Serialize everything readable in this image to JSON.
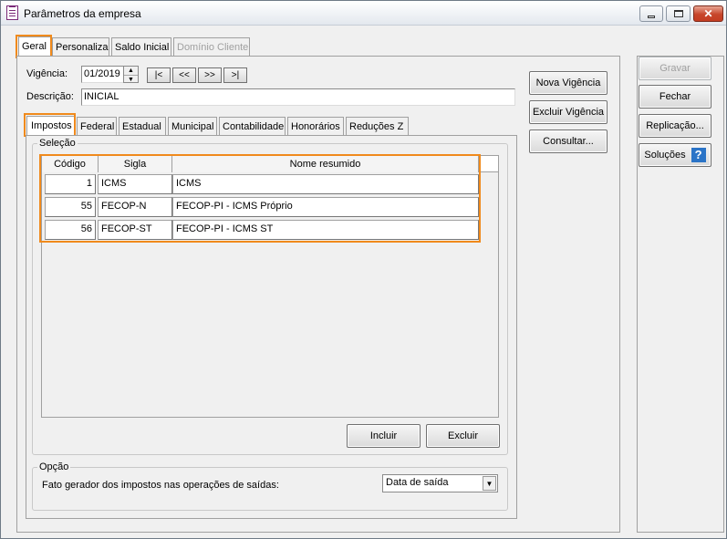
{
  "window": {
    "title": "Parâmetros da empresa",
    "icon": "document-icon"
  },
  "main_tabs": [
    {
      "label": "Geral",
      "state": "active"
    },
    {
      "label": "Personaliza",
      "state": "normal"
    },
    {
      "label": "Saldo Inicial",
      "state": "normal"
    },
    {
      "label": "Domínio Cliente",
      "state": "disabled"
    }
  ],
  "form": {
    "vigencia_label": "Vigência:",
    "vigencia_value": "01/2019",
    "nav": {
      "first": "|<",
      "prev": "<<",
      "next": ">>",
      "last": ">|"
    },
    "descricao_label": "Descrição:",
    "descricao_value": "INICIAL"
  },
  "sub_tabs": [
    {
      "label": "Impostos",
      "state": "active"
    },
    {
      "label": "Federal",
      "state": "normal"
    },
    {
      "label": "Estadual",
      "state": "normal"
    },
    {
      "label": "Municipal",
      "state": "normal"
    },
    {
      "label": "Contabilidade",
      "state": "normal"
    },
    {
      "label": "Honorários",
      "state": "normal"
    },
    {
      "label": "Reduções Z",
      "state": "normal"
    }
  ],
  "selecao": {
    "legend": "Seleção",
    "columns": [
      "Código",
      "Sigla",
      "Nome resumido"
    ],
    "rows": [
      {
        "codigo": "1",
        "sigla": "ICMS",
        "nome": "ICMS"
      },
      {
        "codigo": "55",
        "sigla": "FECOP-N",
        "nome": "FECOP-PI - ICMS Próprio"
      },
      {
        "codigo": "56",
        "sigla": "FECOP-ST",
        "nome": "FECOP-PI - ICMS ST"
      }
    ],
    "incluir": "Incluir",
    "excluir": "Excluir"
  },
  "opcao": {
    "legend": "Opção",
    "label": "Fato gerador dos impostos nas operações de saídas:",
    "value": "Data de saída"
  },
  "vigencia_buttons": {
    "nova": "Nova Vigência",
    "excluir": "Excluir Vigência",
    "consultar": "Consultar..."
  },
  "side_buttons": {
    "gravar": "Gravar",
    "fechar": "Fechar",
    "replicacao": "Replicação...",
    "solucoes": "Soluções",
    "help": "?"
  },
  "colors": {
    "highlight": "#f08a1c",
    "close_button": "#c7462b",
    "help_icon": "#2b74c7"
  }
}
